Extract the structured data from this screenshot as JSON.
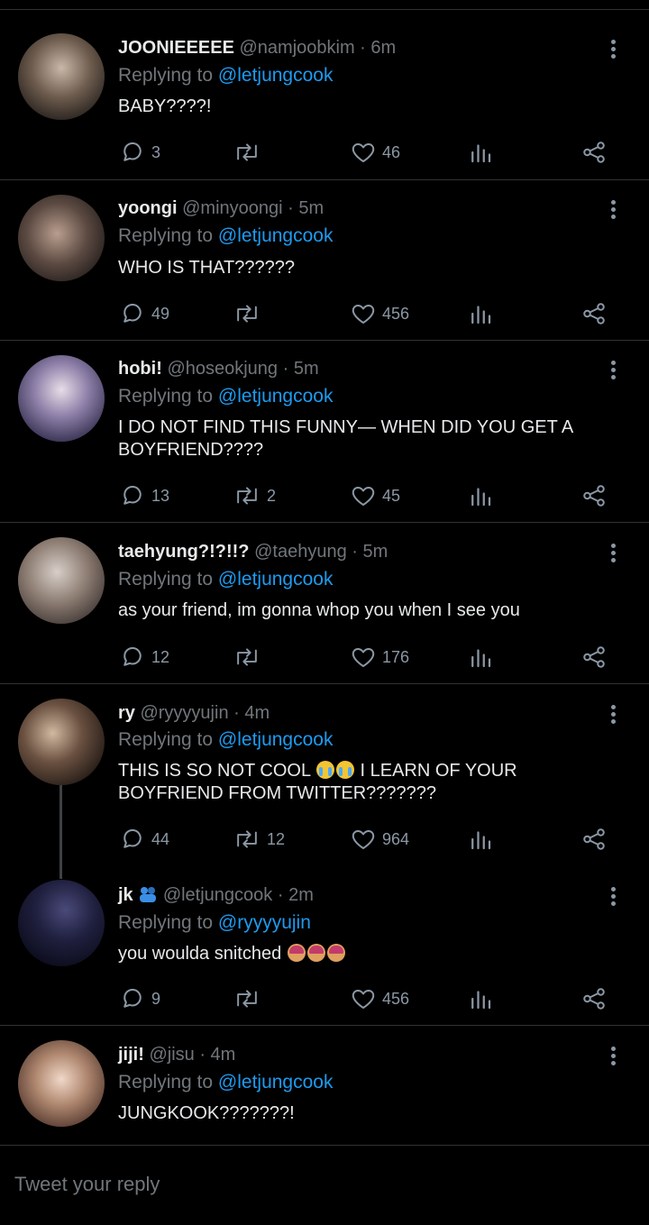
{
  "tweets": [
    {
      "name": "JOONIEEEEE",
      "handle": "@namjoobkim",
      "time": "6m",
      "reply_prefix": "Replying to ",
      "reply_to": "@letjungcook",
      "text": "BABY????!",
      "replies": "3",
      "retweets": "",
      "likes": "46"
    },
    {
      "name": "yoongi",
      "handle": "@minyoongi",
      "time": "5m",
      "reply_prefix": "Replying to ",
      "reply_to": "@letjungcook",
      "text": "WHO IS THAT??????",
      "replies": "49",
      "retweets": "",
      "likes": "456"
    },
    {
      "name": "hobi!",
      "handle": "@hoseokjung",
      "time": "5m",
      "reply_prefix": "Replying to ",
      "reply_to": "@letjungcook",
      "text": "I DO NOT FIND THIS FUNNY— WHEN DID YOU GET A BOYFRIEND????",
      "replies": "13",
      "retweets": "2",
      "likes": "45"
    },
    {
      "name": "taehyung?!?!!?",
      "handle": "@taehyung",
      "time": "5m",
      "reply_prefix": "Replying to ",
      "reply_to": "@letjungcook",
      "text": "as your friend, im gonna whop you when I see you",
      "replies": "12",
      "retweets": "",
      "likes": "176"
    },
    {
      "name": "ry",
      "handle": "@ryyyyujin",
      "time": "4m",
      "reply_prefix": "Replying to ",
      "reply_to": "@letjungcook",
      "text_a": "THIS IS SO NOT COOL",
      "text_b": " I LEARN OF YOUR BOYFRIEND FROM TWITTER???????",
      "replies": "44",
      "retweets": "12",
      "likes": "964"
    },
    {
      "name": "jk",
      "handle": "@letjungcook",
      "time": "2m",
      "reply_prefix": "Replying to ",
      "reply_to": "@ryyyyujin",
      "text": "you woulda snitched ",
      "replies": "9",
      "retweets": "",
      "likes": "456"
    },
    {
      "name": "jiji!",
      "handle": "@jisu",
      "time": "4m",
      "reply_prefix": "Replying to ",
      "reply_to": "@letjungcook",
      "text": "JUNGKOOK???????!"
    }
  ],
  "compose": {
    "placeholder": "Tweet your reply"
  },
  "separator": " · ",
  "icons": {
    "reply": "reply-icon",
    "retweet": "retweet-icon",
    "like": "heart-icon",
    "stats": "stats-icon",
    "share": "share-icon",
    "more": "more-icon"
  },
  "colors": {
    "background": "#000000",
    "mention": "#1d9bf0",
    "muted": "#71767b",
    "divider": "#2f3336"
  }
}
